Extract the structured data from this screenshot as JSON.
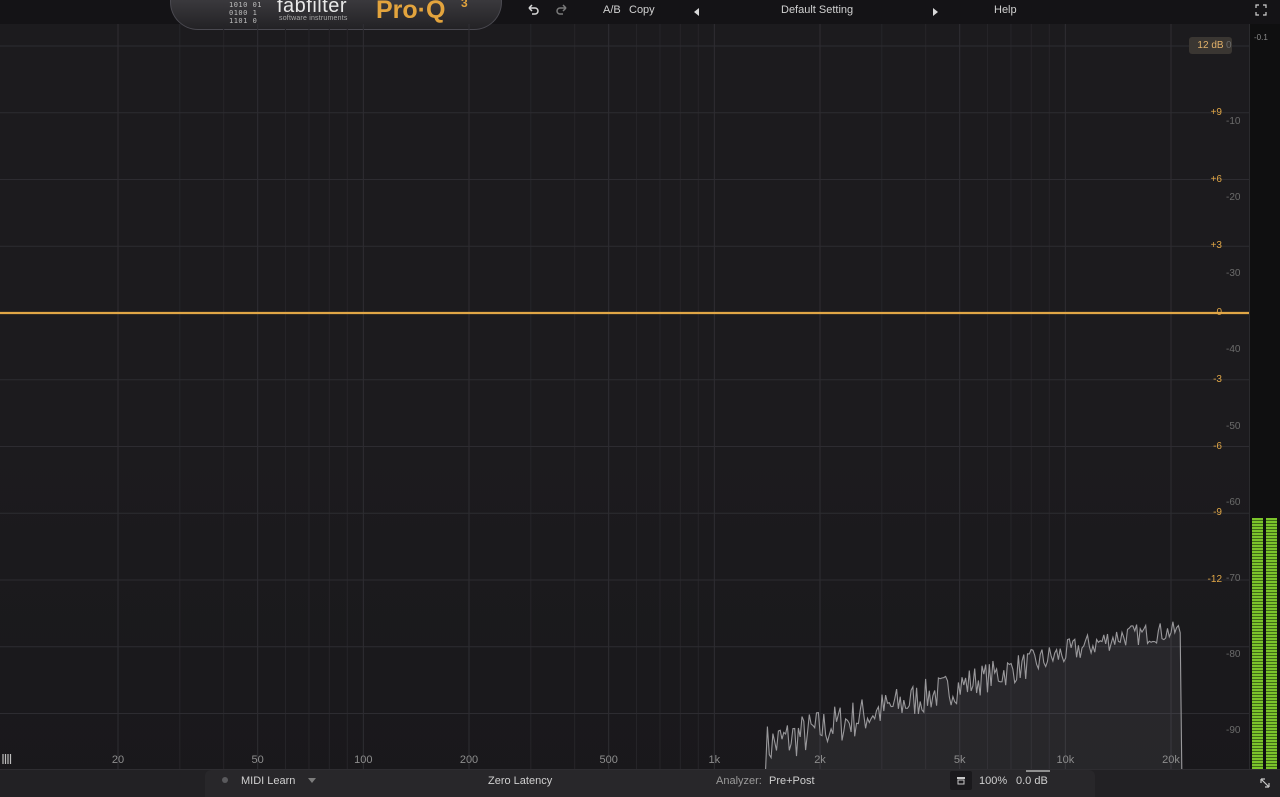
{
  "brand": {
    "bits": "1010 01\n0100 1\n1101 0",
    "name": "fabfilter",
    "tagline": "software instruments",
    "product": "Pro·Q",
    "version": "3"
  },
  "toolbar": {
    "undo_icon": "undo-icon",
    "redo_icon": "redo-icon",
    "ab_label": "A/B",
    "copy_label": "Copy",
    "preset_prev_icon": "triangle-left-icon",
    "preset_name": "Default Setting",
    "preset_next_icon": "triangle-right-icon",
    "help_label": "Help",
    "fullscreen_icon": "fullscreen-icon"
  },
  "graph": {
    "range_badge": "12 dB",
    "eq_gain_labels": [
      "+9",
      "+6",
      "+3",
      "0",
      "-3",
      "-6",
      "-9",
      "-12"
    ],
    "analyzer_labels": [
      "0",
      "-10",
      "-20",
      "-30",
      "-40",
      "-50",
      "-60",
      "-70",
      "-80",
      "-90"
    ],
    "freq_labels": [
      "20",
      "50",
      "100",
      "200",
      "500",
      "1k",
      "2k",
      "5k",
      "10k",
      "20k"
    ],
    "colors": {
      "eq_curve": "#e0a646",
      "spectrum": "#9a999c",
      "grid": "#2b2a2e"
    },
    "meter_peak": "-0.1",
    "meter_level_db": -62
  },
  "bottom": {
    "piano_icon": "piano-icon",
    "midi_learn": "MIDI Learn",
    "latency": "Zero Latency",
    "analyzer_label": "Analyzer:",
    "analyzer_value": "Pre+Post",
    "output_icon": "output-icon",
    "zoom": "100%",
    "output_gain": "0.0 dB",
    "resize_icon": "resize-icon"
  }
}
